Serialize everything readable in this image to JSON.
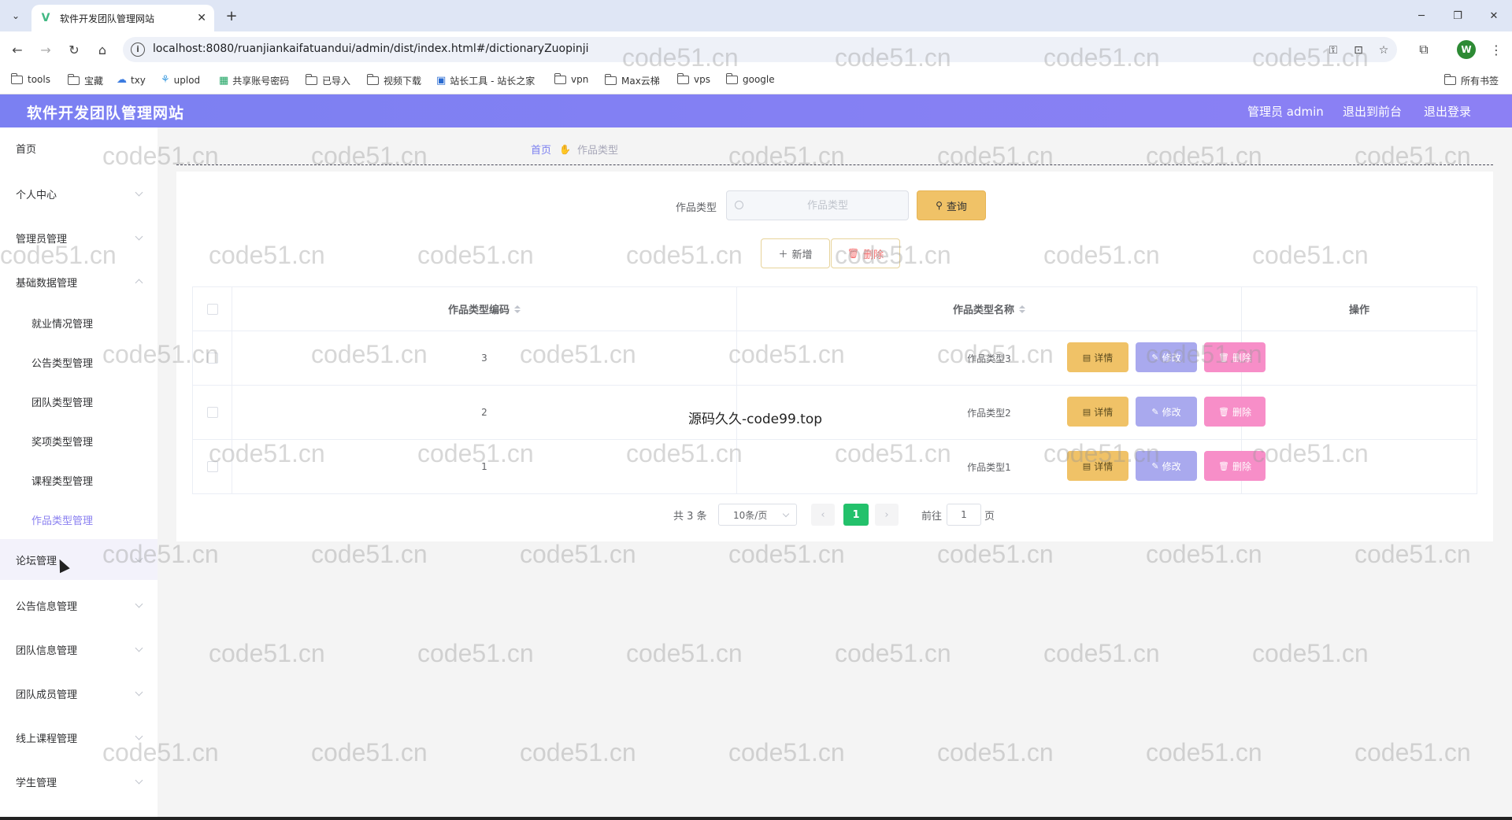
{
  "browser": {
    "tab_title": "软件开发团队管理网站",
    "url": "localhost:8080/ruanjiankaifatuandui/admin/dist/index.html#/dictionaryZuopinji",
    "profile_initial": "W",
    "bookmarks": [
      "tools",
      "宝藏",
      "txy",
      "uplod",
      "共享账号密码",
      "已导入",
      "视频下载",
      "站长工具 - 站长之家",
      "vpn",
      "Max云梯",
      "vps",
      "google"
    ],
    "all_bookmarks": "所有书签"
  },
  "header": {
    "title": "软件开发团队管理网站",
    "user": "管理员 admin",
    "to_front": "退出到前台",
    "logout": "退出登录"
  },
  "sidebar": {
    "items": [
      {
        "label": "首页"
      },
      {
        "label": "个人中心"
      },
      {
        "label": "管理员管理"
      },
      {
        "label": "基础数据管理"
      },
      {
        "label": "论坛管理"
      },
      {
        "label": "公告信息管理"
      },
      {
        "label": "团队信息管理"
      },
      {
        "label": "团队成员管理"
      },
      {
        "label": "线上课程管理"
      },
      {
        "label": "学生管理"
      }
    ],
    "sub_items": [
      {
        "label": "就业情况管理"
      },
      {
        "label": "公告类型管理"
      },
      {
        "label": "团队类型管理"
      },
      {
        "label": "奖项类型管理"
      },
      {
        "label": "课程类型管理"
      },
      {
        "label": "作品类型管理"
      }
    ]
  },
  "breadcrumb": {
    "home": "首页",
    "current": "作品类型"
  },
  "search": {
    "label": "作品类型",
    "placeholder": "作品类型",
    "query_button": "查询"
  },
  "actions": {
    "add": "新增",
    "delete": "删除"
  },
  "table": {
    "headers": {
      "code": "作品类型编码",
      "name": "作品类型名称",
      "operation": "操作"
    },
    "rows": [
      {
        "code": "3",
        "name": "作品类型3"
      },
      {
        "code": "2",
        "name": "作品类型2"
      },
      {
        "code": "1",
        "name": "作品类型1"
      }
    ],
    "row_actions": {
      "detail": "详情",
      "edit": "修改",
      "remove": "删除"
    }
  },
  "pagination": {
    "total": "共 3 条",
    "page_size": "10条/页",
    "current_page": "1",
    "goto_label": "前往",
    "goto_value": "1",
    "page_unit": "页"
  },
  "overlay_text": "源码久久-code99.top",
  "watermark": "code51.cn",
  "colors": {
    "header_gradient_start": "#7b80f2",
    "header_gradient_end": "#8c80f4",
    "accent": "#8a80f0",
    "query_button": "#f0c267",
    "edit_button": "#a9a9ee",
    "delete_button": "#f78ec8",
    "active_page": "#23c16b"
  }
}
